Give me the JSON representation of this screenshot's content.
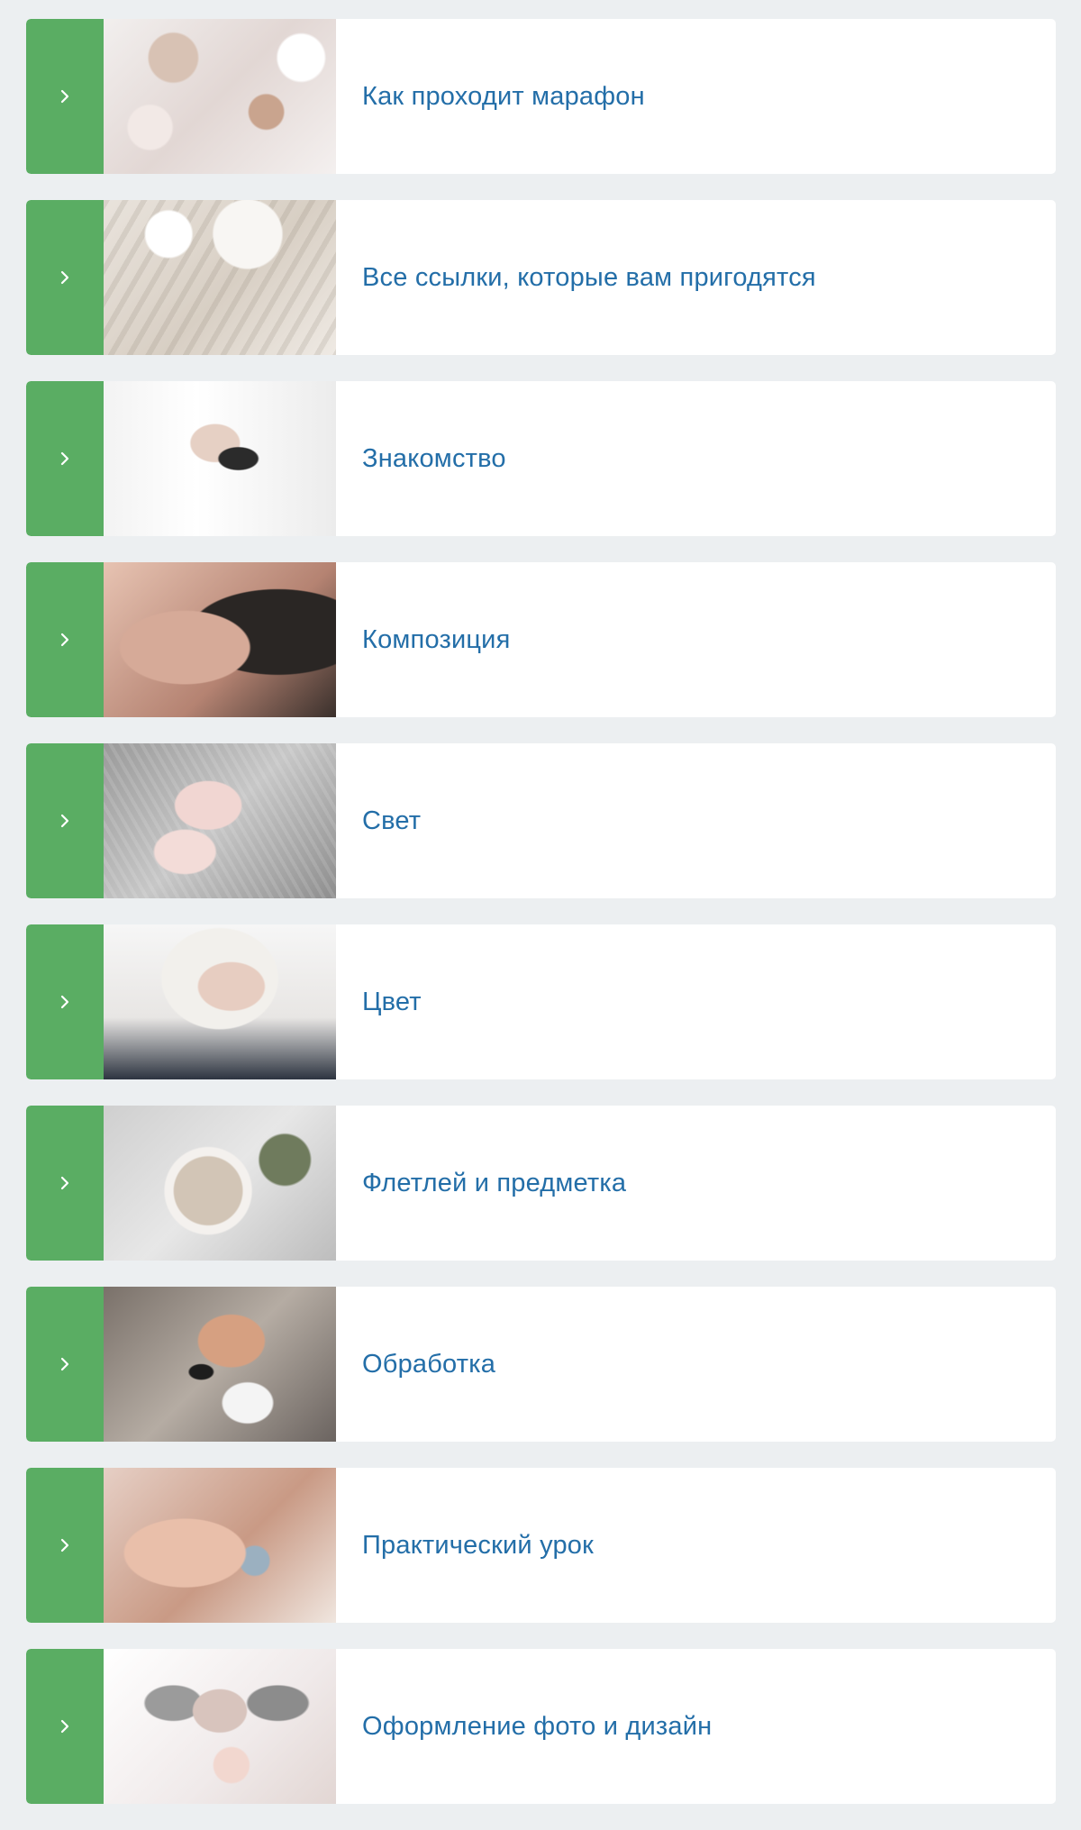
{
  "accent_color": "#5aad63",
  "title_color": "#236ea8",
  "items": [
    {
      "title": "Как проходит марафон",
      "icon": "chevron-right-icon"
    },
    {
      "title": "Все ссылки, которые вам пригодятся",
      "icon": "chevron-right-icon"
    },
    {
      "title": "Знакомство",
      "icon": "chevron-right-icon"
    },
    {
      "title": "Композиция",
      "icon": "chevron-right-icon"
    },
    {
      "title": "Свет",
      "icon": "chevron-right-icon"
    },
    {
      "title": "Цвет",
      "icon": "chevron-right-icon"
    },
    {
      "title": "Флетлей и предметка",
      "icon": "chevron-right-icon"
    },
    {
      "title": "Обработка",
      "icon": "chevron-right-icon"
    },
    {
      "title": "Практический урок",
      "icon": "chevron-right-icon"
    },
    {
      "title": "Оформление фото и дизайн",
      "icon": "chevron-right-icon"
    }
  ]
}
